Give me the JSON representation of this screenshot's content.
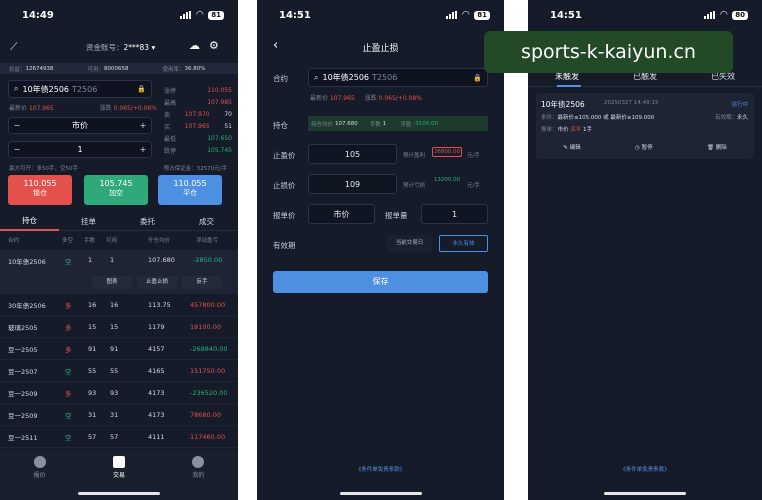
{
  "panel1": {
    "status": {
      "time": "14:49",
      "battery": "81"
    },
    "header": {
      "account_label": "资金账号：",
      "account_value": "2***83"
    },
    "account": {
      "equity_label": "权益：",
      "equity_value": "12674938",
      "available_label": "可用：",
      "available_value": "8000658",
      "usage_label": "使用率：",
      "usage_value": "36.80%"
    },
    "contract": {
      "name": "10年债2506",
      "code": "T2506"
    },
    "quote": {
      "last_label": "最新价",
      "last_value": "107.965",
      "change_label": "涨跌",
      "change_value": "0.065/+0.06%",
      "limit_up_label": "涨停",
      "limit_up_value": "110.055",
      "high_label": "最高",
      "high_value": "107.985",
      "sell_label": "卖",
      "sell_price": "107.970",
      "sell_qty": "70",
      "buy_label": "买",
      "buy_price": "107.965",
      "buy_qty": "51",
      "low_label": "最低",
      "low_value": "107.650",
      "limit_down_label": "跌停",
      "limit_down_value": "105.745"
    },
    "order": {
      "price_type": "市价",
      "quantity": "1",
      "max_open": "最大可开：多50手，空50手",
      "est_margin": "预占保证金：32570元/手"
    },
    "buttons": {
      "buy_open_price": "110.055",
      "buy_open_label": "锁仓",
      "sell_open_price": "105.745",
      "sell_open_label": "加空",
      "close_price": "110.055",
      "close_label": "平仓"
    },
    "tabs": [
      "持仓",
      "挂单",
      "委托",
      "成交"
    ],
    "columns": [
      "合约",
      "多空",
      "手数",
      "可用",
      "开仓均价",
      "浮动盈亏"
    ],
    "selected_row": {
      "name": "10年债2506",
      "side": "空",
      "qty": "1",
      "avail": "1",
      "price": "107.680",
      "pnl": "-2850.00"
    },
    "row_actions": [
      "图表",
      "止盈止损",
      "反手"
    ],
    "rows": [
      {
        "name": "30年债2506",
        "side": "多",
        "qty": "16",
        "avail": "16",
        "price": "113.75",
        "pnl": "457800.00"
      },
      {
        "name": "玻璃2505",
        "side": "多",
        "qty": "15",
        "avail": "15",
        "price": "1179",
        "pnl": "18100.00"
      },
      {
        "name": "豆一2505",
        "side": "多",
        "qty": "91",
        "avail": "91",
        "price": "4157",
        "pnl": "-268840.00"
      },
      {
        "name": "豆一2507",
        "side": "空",
        "qty": "55",
        "avail": "55",
        "price": "4165",
        "pnl": "151750.00"
      },
      {
        "name": "豆一2509",
        "side": "多",
        "qty": "93",
        "avail": "93",
        "price": "4173",
        "pnl": "-236520.00"
      },
      {
        "name": "豆一2509",
        "side": "空",
        "qty": "31",
        "avail": "31",
        "price": "4173",
        "pnl": "78680.00"
      },
      {
        "name": "豆一2511",
        "side": "空",
        "qty": "57",
        "avail": "57",
        "price": "4111",
        "pnl": "117460.00"
      }
    ],
    "nav": [
      "报价",
      "交易",
      "我的"
    ]
  },
  "panel2": {
    "status": {
      "time": "14:51",
      "battery": "81"
    },
    "title": "止盈止损",
    "contract_label": "合约",
    "contract_name": "10年债2506",
    "contract_code": "T2506",
    "last_label": "最新价",
    "last_value": "107.965",
    "change_label": "涨跌",
    "change_value": "0.065/+0.08%",
    "position_label": "持仓",
    "avg_label": "持仓均价",
    "avg_value": "107.680",
    "qty_label": "手数",
    "qty_value": "1",
    "float_label": "浮盈",
    "float_value": "-3100.00",
    "tp_label": "止盈价",
    "tp_value": "105",
    "tp_est_label": "预计盈利",
    "tp_est_value": "26800.00",
    "sl_label": "止损价",
    "sl_value": "109",
    "sl_est_label": "预计亏损",
    "sl_est_value": "13200.00",
    "unit": "元/手",
    "order_price_label": "报单价",
    "order_price_value": "市价",
    "order_qty_label": "报单量",
    "order_qty_value": "1",
    "validity_label": "有效期",
    "validity_opt1": "当前交易日",
    "validity_opt2": "永久有效",
    "save_label": "保存",
    "footer": "《条件单免责条款》"
  },
  "panel3": {
    "status": {
      "time": "14:51",
      "battery": "80"
    },
    "tabs": [
      "未触发",
      "已触发",
      "已失效"
    ],
    "card": {
      "name": "10年债2506",
      "time": "20250327 14:49:15",
      "status": "运行中",
      "cond_label": "条件：",
      "cond_value": "最新价≤105.000 或 最新价≥109.000",
      "valid_label": "有效期：",
      "valid_value": "永久",
      "order_label": "报单：",
      "order_value_a": "市价",
      "order_value_b": "买平",
      "order_value_c": "1手",
      "actions": [
        "编辑",
        "暂停",
        "删除"
      ]
    },
    "footer": "《条件单免责条款》"
  },
  "watermark": "sports-k-kaiyun.cn"
}
